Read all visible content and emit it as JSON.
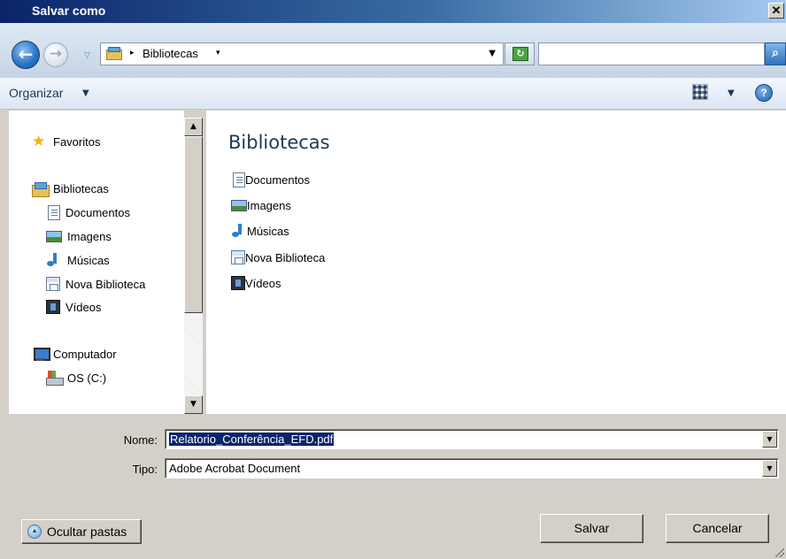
{
  "window": {
    "title": "Salvar como",
    "close_glyph": "✕"
  },
  "address_bar": {
    "back_glyph": "←",
    "forward_glyph": "→",
    "history_glyph": "▽",
    "breadcrumb_sep": "▸",
    "breadcrumb": "Bibliotecas",
    "breadcrumb_arrow": "▾",
    "dropdown_glyph": "▼",
    "refresh_glyph": "↻",
    "search_placeholder": "",
    "search_glyph": "⌕"
  },
  "toolbar": {
    "organize_label": "Organizar",
    "organize_arrow": "▼",
    "views_arrow": "▼",
    "help_glyph": "?"
  },
  "nav_pane": {
    "favorites": "Favoritos",
    "libraries": "Bibliotecas",
    "library_items": [
      "Documentos",
      "Imagens",
      "Músicas",
      "Nova Biblioteca",
      "Vídeos"
    ],
    "computer": "Computador",
    "drive": "OS (C:)",
    "scroll_up": "▲",
    "scroll_down": "▼"
  },
  "content": {
    "title": "Bibliotecas",
    "items": [
      "Documentos",
      "Imagens",
      "Músicas",
      "Nova Biblioteca",
      "Vídeos"
    ]
  },
  "form": {
    "name_label": "Nome:",
    "name_value": "Relatorio_Conferência_EFD.pdf",
    "type_label": "Tipo:",
    "type_value": "Adobe Acrobat Document",
    "dropdown_glyph": "▼"
  },
  "buttons": {
    "hide_folders": "Ocultar pastas",
    "hide_folders_glyph": "▲",
    "save": "Salvar",
    "cancel": "Cancelar"
  }
}
